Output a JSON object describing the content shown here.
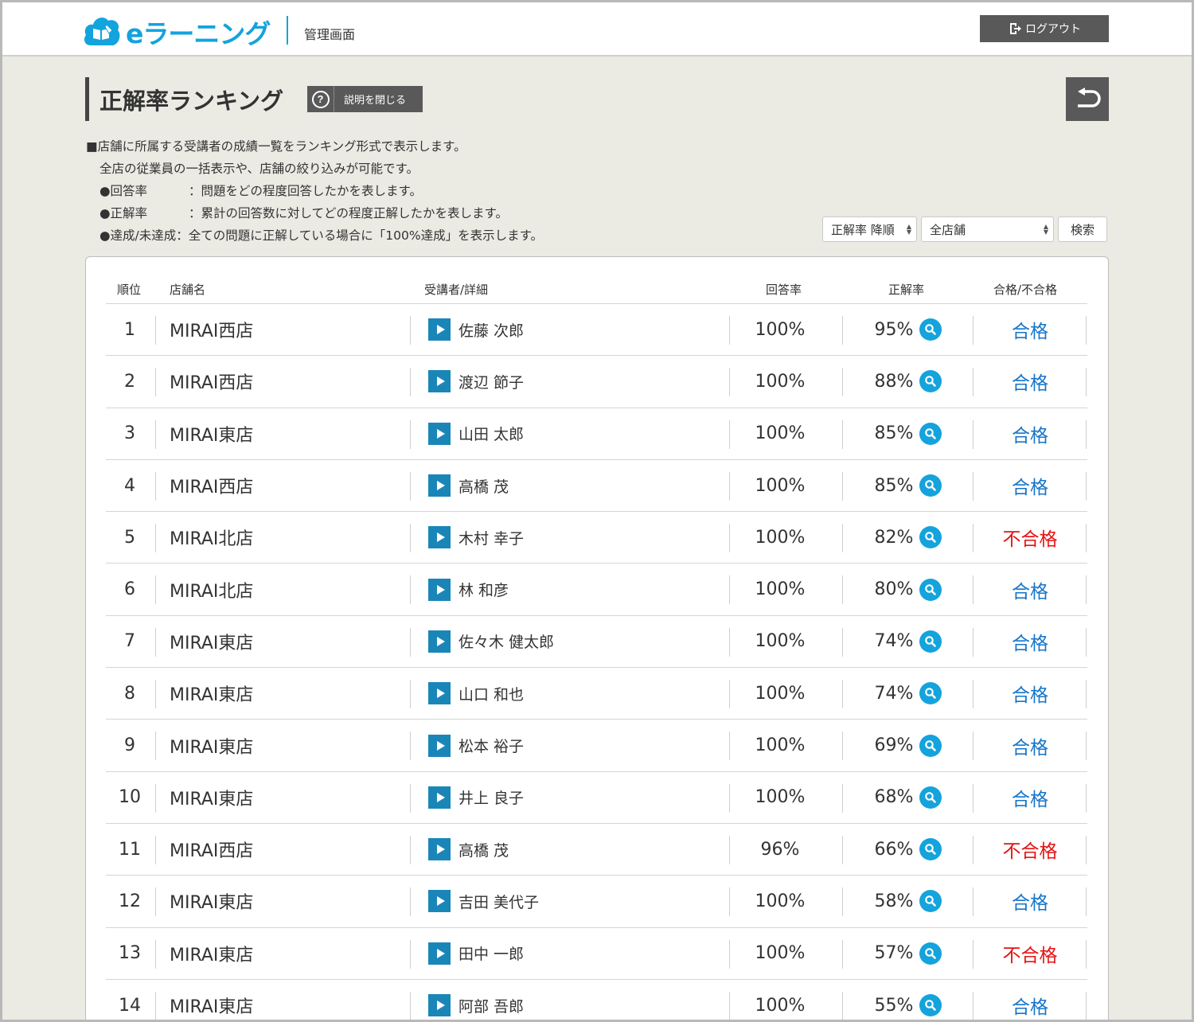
{
  "header": {
    "logo_text": "eラーニング",
    "admin_label": "管理画面",
    "logout_label": "ログアウト"
  },
  "page": {
    "title": "正解率ランキング",
    "help_button_label": "説明を閉じる"
  },
  "description": {
    "line1": "■店舗に所属する受講者の成績一覧をランキング形式で表示します。",
    "line2": "全店の従業員の一括表示や、店舗の絞り込みが可能です。",
    "items": [
      {
        "term": "●回答率",
        "text": "：問題をどの程度回答したかを表します。"
      },
      {
        "term": "●正解率",
        "text": "：累計の回答数に対してどの程度正解したかを表します。"
      },
      {
        "term": "●達成/未達成",
        "text": "：全ての問題に正解している場合に「100%達成」を表示します。"
      }
    ]
  },
  "filters": {
    "sort_value": "正解率 降順",
    "store_value": "全店舗",
    "search_label": "検索"
  },
  "table": {
    "headers": {
      "rank": "順位",
      "store": "店舗名",
      "learner": "受講者/詳細",
      "answer_rate": "回答率",
      "correct_rate": "正解率",
      "result": "合格/不合格"
    },
    "rows": [
      {
        "rank": "1",
        "store": "MIRAI西店",
        "name": "佐藤 次郎",
        "answer": "100%",
        "correct": "95%",
        "result": "合格",
        "pass": true
      },
      {
        "rank": "2",
        "store": "MIRAI西店",
        "name": "渡辺 節子",
        "answer": "100%",
        "correct": "88%",
        "result": "合格",
        "pass": true
      },
      {
        "rank": "3",
        "store": "MIRAI東店",
        "name": "山田 太郎",
        "answer": "100%",
        "correct": "85%",
        "result": "合格",
        "pass": true
      },
      {
        "rank": "4",
        "store": "MIRAI西店",
        "name": "高橋 茂",
        "answer": "100%",
        "correct": "85%",
        "result": "合格",
        "pass": true
      },
      {
        "rank": "5",
        "store": "MIRAI北店",
        "name": "木村 幸子",
        "answer": "100%",
        "correct": "82%",
        "result": "不合格",
        "pass": false
      },
      {
        "rank": "6",
        "store": "MIRAI北店",
        "name": "林 和彦",
        "answer": "100%",
        "correct": "80%",
        "result": "合格",
        "pass": true
      },
      {
        "rank": "7",
        "store": "MIRAI東店",
        "name": "佐々木 健太郎",
        "answer": "100%",
        "correct": "74%",
        "result": "合格",
        "pass": true
      },
      {
        "rank": "8",
        "store": "MIRAI東店",
        "name": "山口 和也",
        "answer": "100%",
        "correct": "74%",
        "result": "合格",
        "pass": true
      },
      {
        "rank": "9",
        "store": "MIRAI東店",
        "name": "松本 裕子",
        "answer": "100%",
        "correct": "69%",
        "result": "合格",
        "pass": true
      },
      {
        "rank": "10",
        "store": "MIRAI東店",
        "name": "井上 良子",
        "answer": "100%",
        "correct": "68%",
        "result": "合格",
        "pass": true
      },
      {
        "rank": "11",
        "store": "MIRAI西店",
        "name": "高橋 茂",
        "answer": "96%",
        "correct": "66%",
        "result": "不合格",
        "pass": false
      },
      {
        "rank": "12",
        "store": "MIRAI東店",
        "name": "吉田 美代子",
        "answer": "100%",
        "correct": "58%",
        "result": "合格",
        "pass": true
      },
      {
        "rank": "13",
        "store": "MIRAI東店",
        "name": "田中 一郎",
        "answer": "100%",
        "correct": "57%",
        "result": "不合格",
        "pass": false
      },
      {
        "rank": "14",
        "store": "MIRAI東店",
        "name": "阿部 吾郎",
        "answer": "100%",
        "correct": "55%",
        "result": "合格",
        "pass": true
      }
    ]
  },
  "colors": {
    "brand": "#13a3dd",
    "pass": "#1675c9",
    "fail": "#e51212",
    "button_dark": "#595959",
    "background": "#ebeae3"
  },
  "icons": {
    "logo": "cloud-book-icon",
    "logout": "logout-icon",
    "help": "question-circle-icon",
    "back": "return-arrow-icon",
    "detail": "play-icon",
    "magnify": "search-icon"
  }
}
